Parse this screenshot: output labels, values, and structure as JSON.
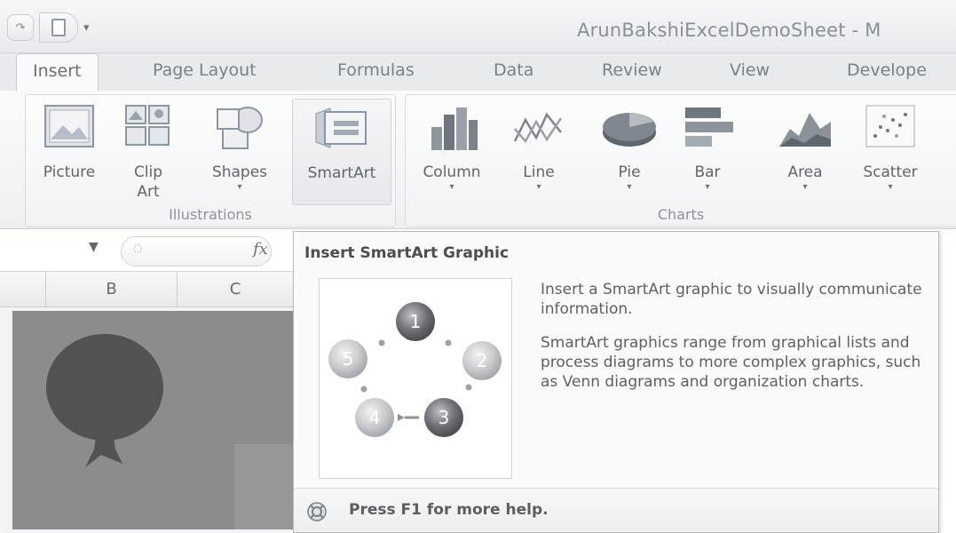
{
  "window": {
    "title": "ArunBakshiExcelDemoSheet - M"
  },
  "tabs": [
    {
      "label": "Insert",
      "active": true
    },
    {
      "label": "Page Layout"
    },
    {
      "label": "Formulas"
    },
    {
      "label": "Data"
    },
    {
      "label": "Review"
    },
    {
      "label": "View"
    },
    {
      "label": "Develope"
    }
  ],
  "ribbon": {
    "illustrations": {
      "label": "Illustrations",
      "buttons": [
        {
          "label": "Picture",
          "icon": "picture-icon"
        },
        {
          "label": "Clip",
          "label2": "Art",
          "icon": "clip-art-icon"
        },
        {
          "label": "Shapes",
          "icon": "shapes-icon"
        },
        {
          "label": "SmartArt",
          "icon": "smartart-icon"
        }
      ]
    },
    "charts": {
      "label": "Charts",
      "buttons": [
        {
          "label": "Column",
          "icon": "column-chart-icon"
        },
        {
          "label": "Line",
          "icon": "line-chart-icon"
        },
        {
          "label": "Pie",
          "icon": "pie-chart-icon"
        },
        {
          "label": "Bar",
          "icon": "bar-chart-icon"
        },
        {
          "label": "Area",
          "icon": "area-chart-icon"
        },
        {
          "label": "Scatter",
          "icon": "scatter-chart-icon"
        }
      ]
    }
  },
  "formula_bar": {
    "fx": "fx"
  },
  "columns": [
    "B",
    "C"
  ],
  "tooltip": {
    "title": "Insert SmartArt Graphic",
    "description": "Insert a SmartArt graphic to visually communicate information.",
    "detail": "SmartArt graphics range from graphical lists and process diagrams to more complex graphics, such as Venn diagrams and organization charts.",
    "help": "Press F1 for more help.",
    "diagram_numbers": [
      "1",
      "2",
      "3",
      "4",
      "5"
    ]
  }
}
